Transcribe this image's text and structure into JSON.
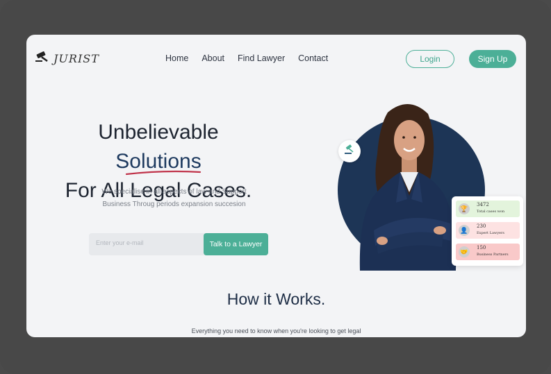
{
  "brand": {
    "name": "JURIST",
    "logo_icon": "gavel-icon"
  },
  "nav": {
    "items": [
      "Home",
      "About",
      "Find Lawyer",
      "Contact"
    ]
  },
  "auth": {
    "login": "Login",
    "signup": "Sign Up"
  },
  "hero": {
    "title_part1": "Unbelievable ",
    "title_accent": "Solutions",
    "title_line2": "For All Legal Cases.",
    "subtitle": "We specialise in all aspects of law and Support Business Throug periods expansion succesion",
    "email_placeholder": "Enter your e-mail",
    "cta": "Talk to a Lawyer"
  },
  "stats": [
    {
      "value": "3472",
      "label": "Total cases won",
      "icon": "trophy-icon",
      "color": "#e3f4dc"
    },
    {
      "value": "230",
      "label": "Expert Lawyers",
      "icon": "lawyer-icon",
      "color": "#fde2e2"
    },
    {
      "value": "150",
      "label": "Business Partners",
      "icon": "handshake-icon",
      "color": "#f9c9c9"
    }
  ],
  "how": {
    "title": "How it Works.",
    "subtitle": "Everything you need to know when you're looking to get legal"
  },
  "colors": {
    "accent": "#4caf97",
    "navy": "#1d3556",
    "underline": "#c0334a"
  }
}
